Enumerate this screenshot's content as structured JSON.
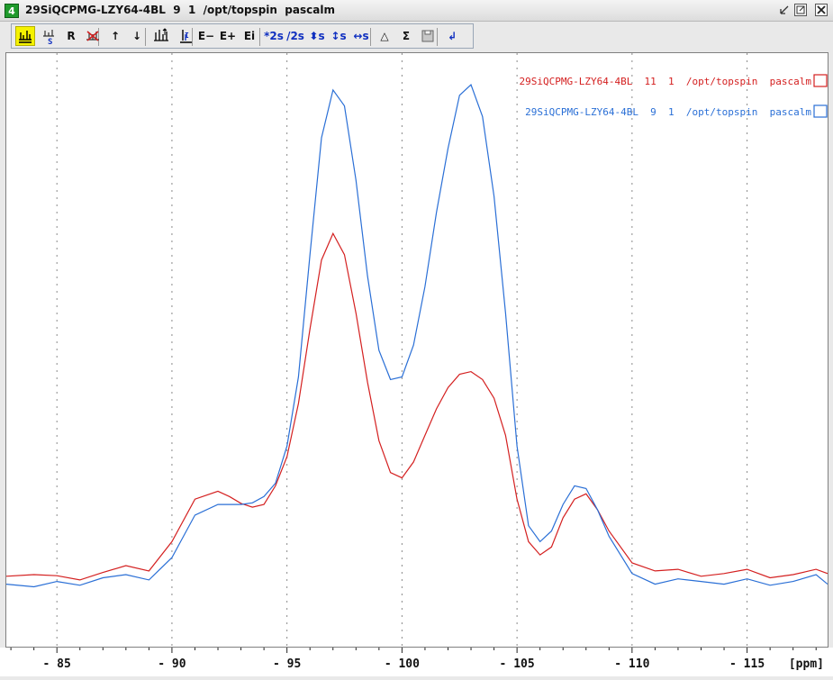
{
  "window": {
    "number": "4",
    "title": "29SiQCPMG-LZY64-4BL  9  1  /opt/topspin  pascalm"
  },
  "toolbar": {
    "buttons": [
      {
        "name": "overlay-display-button",
        "label": "",
        "icon": "stack-peaks-icon",
        "active": true
      },
      {
        "name": "shift-spectrum-button",
        "label": "",
        "icon": "shift-s-icon"
      },
      {
        "name": "reset-button",
        "label": "R",
        "icon": "reset-icon"
      },
      {
        "name": "remove-spectrum-button",
        "label": "",
        "icon": "remove-peaks-icon"
      },
      {
        "name": "move-up-button",
        "label": "↑",
        "icon": "arrow-up-icon"
      },
      {
        "name": "move-down-button",
        "label": "↓",
        "icon": "arrow-down-icon"
      },
      {
        "name": "stack-button",
        "label": "",
        "icon": "stack-icon"
      },
      {
        "name": "integral-button",
        "label": "",
        "icon": "integral-icon"
      },
      {
        "name": "expand-minus-button",
        "label": "E−",
        "icon": "expand-minus-icon"
      },
      {
        "name": "expand-plus-button",
        "label": "E+",
        "icon": "expand-plus-icon"
      },
      {
        "name": "expand-info-button",
        "label": "Ei",
        "icon": "expand-info-icon"
      },
      {
        "name": "scale-x2-button",
        "label": "*2s",
        "icon": "scale-up-icon"
      },
      {
        "name": "scale-div2-button",
        "label": "/2s",
        "icon": "scale-down-icon"
      },
      {
        "name": "vertical-scale-button",
        "label": "⬍s",
        "icon": "vertical-move-icon"
      },
      {
        "name": "vertical-shift-button",
        "label": "↕s",
        "icon": "vertical-shift-icon"
      },
      {
        "name": "horizontal-shift-button",
        "label": "↔s",
        "icon": "horizontal-shift-icon"
      },
      {
        "name": "difference-button",
        "label": "△",
        "icon": "delta-icon"
      },
      {
        "name": "sum-button",
        "label": "Σ",
        "icon": "sigma-icon"
      },
      {
        "name": "save-button",
        "label": "",
        "icon": "save-icon"
      },
      {
        "name": "return-button",
        "label": "↲",
        "icon": "return-icon"
      }
    ]
  },
  "colors": {
    "red": "#d42020",
    "blue": "#2a6fd6"
  },
  "chart_data": {
    "type": "line",
    "xlabel": "[ppm]",
    "x_reversed": true,
    "xlim": [
      -82.8,
      -118.5
    ],
    "ylim": [
      0,
      1
    ],
    "grid": "vertical dotted",
    "legend_position": "top-right",
    "x_ticks": [
      -85,
      -90,
      -95,
      -100,
      -105,
      -110,
      -115
    ],
    "x_tick_labels": [
      "- 85",
      "- 90",
      "- 95",
      "- 100",
      "- 105",
      "- 110",
      "- 115"
    ],
    "series": [
      {
        "name": "29SiQCPMG-LZY64-4BL  11  1  /opt/topspin  pascalm",
        "color": "#d42020",
        "x": [
          -82.8,
          -84,
          -85,
          -86,
          -87,
          -88,
          -89,
          -90,
          -91,
          -92,
          -92.5,
          -93,
          -93.5,
          -94,
          -94.5,
          -95,
          -95.5,
          -96,
          -96.5,
          -97,
          -97.5,
          -98,
          -98.5,
          -99,
          -99.5,
          -100,
          -100.5,
          -101,
          -101.5,
          -102,
          -102.5,
          -103,
          -103.5,
          -104,
          -104.5,
          -105,
          -105.5,
          -106,
          -106.5,
          -107,
          -107.5,
          -108,
          -108.5,
          -109,
          -110,
          -111,
          -112,
          -113,
          -114,
          -115,
          -116,
          -117,
          -118,
          -118.5
        ],
        "y": [
          0.075,
          0.078,
          0.076,
          0.068,
          0.082,
          0.095,
          0.085,
          0.14,
          0.22,
          0.235,
          0.225,
          0.212,
          0.205,
          0.21,
          0.245,
          0.3,
          0.4,
          0.54,
          0.67,
          0.72,
          0.68,
          0.57,
          0.44,
          0.33,
          0.27,
          0.26,
          0.29,
          0.34,
          0.39,
          0.43,
          0.455,
          0.46,
          0.445,
          0.41,
          0.34,
          0.22,
          0.14,
          0.115,
          0.13,
          0.185,
          0.22,
          0.23,
          0.2,
          0.16,
          0.1,
          0.085,
          0.088,
          0.075,
          0.08,
          0.088,
          0.072,
          0.078,
          0.088,
          0.08
        ]
      },
      {
        "name": "29SiQCPMG-LZY64-4BL  9  1  /opt/topspin  pascalm",
        "color": "#2a6fd6",
        "x": [
          -82.8,
          -84,
          -85,
          -86,
          -87,
          -88,
          -89,
          -90,
          -91,
          -92,
          -92.5,
          -93,
          -93.5,
          -94,
          -94.5,
          -95,
          -95.5,
          -96,
          -96.5,
          -97,
          -97.5,
          -98,
          -98.5,
          -99,
          -99.5,
          -100,
          -100.5,
          -101,
          -101.5,
          -102,
          -102.5,
          -103,
          -103.5,
          -104,
          -104.5,
          -105,
          -105.5,
          -106,
          -106.5,
          -107,
          -107.5,
          -108,
          -108.5,
          -109,
          -110,
          -111,
          -112,
          -113,
          -114,
          -115,
          -116,
          -117,
          -118,
          -118.5
        ],
        "y": [
          0.06,
          0.055,
          0.065,
          0.058,
          0.072,
          0.078,
          0.068,
          0.11,
          0.19,
          0.21,
          0.21,
          0.21,
          0.213,
          0.225,
          0.25,
          0.32,
          0.45,
          0.68,
          0.9,
          0.99,
          0.96,
          0.82,
          0.64,
          0.5,
          0.445,
          0.45,
          0.51,
          0.62,
          0.76,
          0.88,
          0.98,
          1.0,
          0.94,
          0.79,
          0.57,
          0.32,
          0.17,
          0.14,
          0.16,
          0.21,
          0.245,
          0.24,
          0.2,
          0.15,
          0.08,
          0.06,
          0.07,
          0.065,
          0.06,
          0.07,
          0.058,
          0.065,
          0.078,
          0.06
        ]
      }
    ]
  }
}
